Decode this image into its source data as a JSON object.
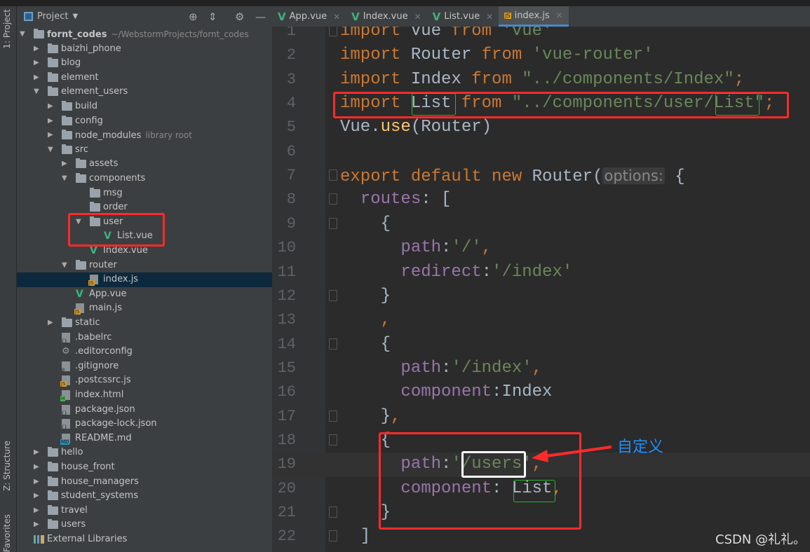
{
  "toolstrip": {
    "project": "1: Project",
    "structure": "Z: Structure",
    "favorites": "Favorites"
  },
  "sidebar": {
    "title": "Project",
    "tree": [
      {
        "label": "fornt_codes",
        "level": 0,
        "type": "folder",
        "state": "open",
        "hint": "~/WebstormProjects/fornt_codes",
        "bold": true
      },
      {
        "label": "baizhi_phone",
        "level": 1,
        "type": "folder",
        "state": "closed"
      },
      {
        "label": "blog",
        "level": 1,
        "type": "folder",
        "state": "closed"
      },
      {
        "label": "element",
        "level": 1,
        "type": "folder",
        "state": "closed"
      },
      {
        "label": "element_users",
        "level": 1,
        "type": "folder",
        "state": "open"
      },
      {
        "label": "build",
        "level": 2,
        "type": "folder",
        "state": "closed"
      },
      {
        "label": "config",
        "level": 2,
        "type": "folder",
        "state": "closed"
      },
      {
        "label": "node_modules",
        "level": 2,
        "type": "folder",
        "state": "closed",
        "hint": "library root"
      },
      {
        "label": "src",
        "level": 2,
        "type": "folder",
        "state": "open"
      },
      {
        "label": "assets",
        "level": 3,
        "type": "folder",
        "state": "closed"
      },
      {
        "label": "components",
        "level": 3,
        "type": "folder",
        "state": "open"
      },
      {
        "label": "msg",
        "level": 4,
        "type": "folder",
        "state": "none"
      },
      {
        "label": "order",
        "level": 4,
        "type": "folder",
        "state": "none"
      },
      {
        "label": "user",
        "level": 4,
        "type": "folder",
        "state": "open"
      },
      {
        "label": "List.vue",
        "level": 5,
        "type": "vue"
      },
      {
        "label": "Index.vue",
        "level": 4,
        "type": "vue"
      },
      {
        "label": "router",
        "level": 3,
        "type": "folder",
        "state": "open"
      },
      {
        "label": "index.js",
        "level": 4,
        "type": "js",
        "selected": true
      },
      {
        "label": "App.vue",
        "level": 3,
        "type": "vue"
      },
      {
        "label": "main.js",
        "level": 3,
        "type": "js"
      },
      {
        "label": "static",
        "level": 2,
        "type": "folder",
        "state": "closed"
      },
      {
        "label": ".babelrc",
        "level": 2,
        "type": "json"
      },
      {
        "label": ".editorconfig",
        "level": 2,
        "type": "gear"
      },
      {
        "label": ".gitignore",
        "level": 2,
        "type": "ignore"
      },
      {
        "label": ".postcssrc.js",
        "level": 2,
        "type": "js"
      },
      {
        "label": "index.html",
        "level": 2,
        "type": "html"
      },
      {
        "label": "package.json",
        "level": 2,
        "type": "json"
      },
      {
        "label": "package-lock.json",
        "level": 2,
        "type": "json"
      },
      {
        "label": "README.md",
        "level": 2,
        "type": "md"
      },
      {
        "label": "hello",
        "level": 1,
        "type": "folder",
        "state": "closed"
      },
      {
        "label": "house_front",
        "level": 1,
        "type": "folder",
        "state": "closed"
      },
      {
        "label": "house_managers",
        "level": 1,
        "type": "folder",
        "state": "closed"
      },
      {
        "label": "student_systems",
        "level": 1,
        "type": "folder",
        "state": "closed"
      },
      {
        "label": "travel",
        "level": 1,
        "type": "folder",
        "state": "closed"
      },
      {
        "label": "users",
        "level": 1,
        "type": "folder",
        "state": "closed"
      },
      {
        "label": "External Libraries",
        "level": 0,
        "type": "lib"
      }
    ]
  },
  "tabs": [
    {
      "label": "App.vue",
      "icon": "vue",
      "active": false
    },
    {
      "label": "Index.vue",
      "icon": "vue",
      "active": false
    },
    {
      "label": "List.vue",
      "icon": "vue",
      "active": false
    },
    {
      "label": "index.js",
      "icon": "js",
      "active": true
    }
  ],
  "editor": {
    "current_line": 19,
    "lines": [
      [
        [
          "kw",
          "import"
        ],
        [
          "pl",
          " Vue "
        ],
        [
          "kw",
          "from"
        ],
        [
          "pl",
          " "
        ],
        [
          "str",
          "'vue'"
        ]
      ],
      [
        [
          "kw",
          "import"
        ],
        [
          "pl",
          " Router "
        ],
        [
          "kw",
          "from"
        ],
        [
          "pl",
          " "
        ],
        [
          "str",
          "'vue-router'"
        ]
      ],
      [
        [
          "kw",
          "import"
        ],
        [
          "pl",
          " Index "
        ],
        [
          "kw",
          "from"
        ],
        [
          "pl",
          " "
        ],
        [
          "str",
          "\"../components/Index\""
        ],
        [
          "pun",
          ";"
        ]
      ],
      [
        [
          "kw",
          "import"
        ],
        [
          "pl",
          " List "
        ],
        [
          "kw",
          "from"
        ],
        [
          "pl",
          " "
        ],
        [
          "str",
          "\"../components/user/List\""
        ],
        [
          "pun",
          ";"
        ]
      ],
      [
        [
          "pl",
          "Vue."
        ],
        [
          "fn",
          "use"
        ],
        [
          "pl",
          "(Router)"
        ]
      ],
      [],
      [
        [
          "kw",
          "export default new"
        ],
        [
          "pl",
          " Router("
        ],
        [
          "inlay",
          "options:"
        ],
        [
          "pl",
          " {"
        ]
      ],
      [
        [
          "pl",
          "  "
        ],
        [
          "prop",
          "routes"
        ],
        [
          "pl",
          ": ["
        ]
      ],
      [
        [
          "pl",
          "    {"
        ]
      ],
      [
        [
          "pl",
          "      "
        ],
        [
          "prop",
          "path"
        ],
        [
          "pl",
          ":"
        ],
        [
          "str",
          "'/'"
        ],
        [
          "pun",
          ","
        ]
      ],
      [
        [
          "pl",
          "      "
        ],
        [
          "prop",
          "redirect"
        ],
        [
          "pl",
          ":"
        ],
        [
          "str",
          "'/index'"
        ]
      ],
      [
        [
          "pl",
          "    }"
        ]
      ],
      [
        [
          "pl",
          "    "
        ],
        [
          "pun",
          ","
        ]
      ],
      [
        [
          "pl",
          "    {"
        ]
      ],
      [
        [
          "pl",
          "      "
        ],
        [
          "prop",
          "path"
        ],
        [
          "pl",
          ":"
        ],
        [
          "str",
          "'/index'"
        ],
        [
          "pun",
          ","
        ]
      ],
      [
        [
          "pl",
          "      "
        ],
        [
          "prop",
          "component"
        ],
        [
          "pl",
          ":Index"
        ]
      ],
      [
        [
          "pl",
          "    }"
        ],
        [
          "pun",
          ","
        ]
      ],
      [
        [
          "pl",
          "    {"
        ]
      ],
      [
        [
          "pl",
          "      "
        ],
        [
          "prop",
          "path"
        ],
        [
          "pl",
          ":"
        ],
        [
          "str",
          "'/users'"
        ],
        [
          "pun",
          ","
        ]
      ],
      [
        [
          "pl",
          "      "
        ],
        [
          "prop",
          "component"
        ],
        [
          "pl",
          ": List"
        ],
        [
          "pun",
          ","
        ]
      ],
      [
        [
          "pl",
          "    }"
        ]
      ],
      [
        [
          "pl",
          "  ]"
        ]
      ]
    ]
  },
  "annotation": {
    "callout": "自定义",
    "highlight_color": "#ff2a2a",
    "callout_color": "#1e90ff"
  },
  "watermark": "CSDN @礼礼。"
}
